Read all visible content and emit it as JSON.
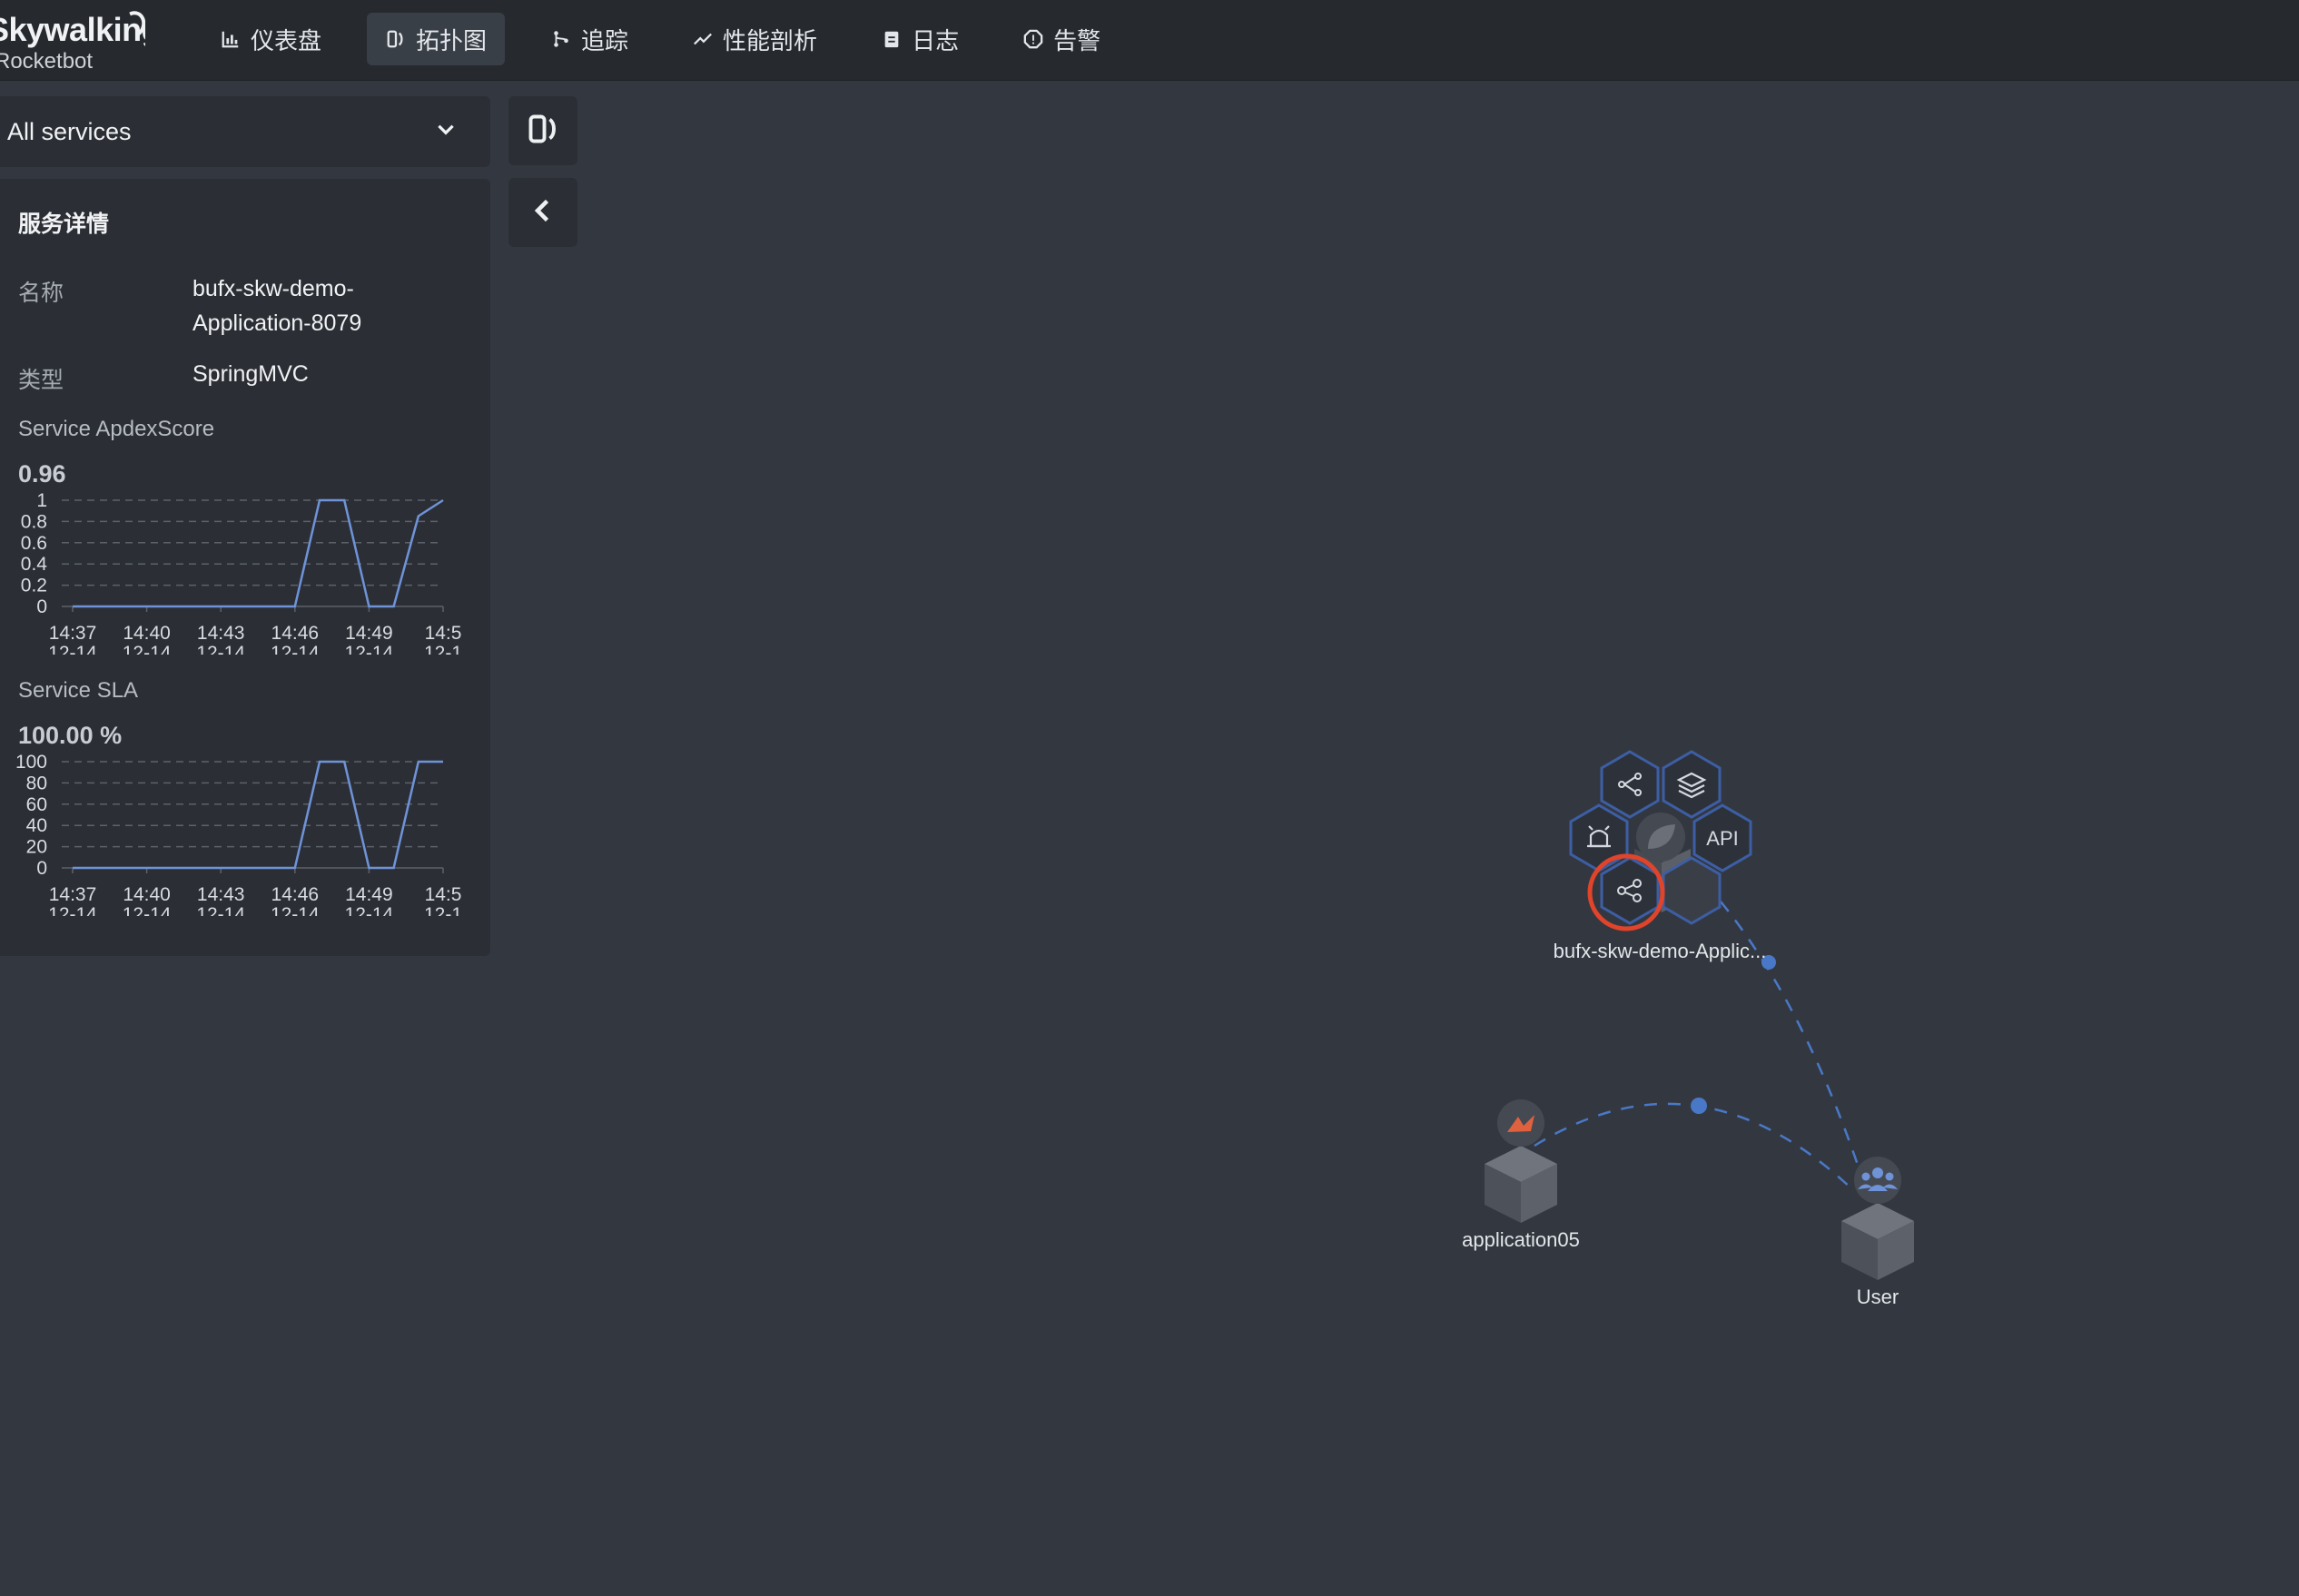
{
  "logo": {
    "line1": "Skywalking",
    "line2": "Rocketbot"
  },
  "nav": [
    {
      "id": "dashboard",
      "label": "仪表盘",
      "icon": "bar-chart-icon",
      "active": false
    },
    {
      "id": "topology",
      "label": "拓扑图",
      "icon": "topology-icon",
      "active": true
    },
    {
      "id": "trace",
      "label": "追踪",
      "icon": "branch-icon",
      "active": false
    },
    {
      "id": "profile",
      "label": "性能剖析",
      "icon": "trend-icon",
      "active": false
    },
    {
      "id": "log",
      "label": "日志",
      "icon": "clipboard-icon",
      "active": false
    },
    {
      "id": "alarm",
      "label": "告警",
      "icon": "alert-icon",
      "active": false
    }
  ],
  "service_select": {
    "value": "All services",
    "icon": "chevron-down-icon"
  },
  "tools": {
    "layout_icon": "topology-layout-icon",
    "collapse_icon": "chevron-left-icon"
  },
  "details": {
    "title": "服务详情",
    "name_label": "名称",
    "name_line1": "bufx-skw-demo-",
    "name_line2": "Application-8079",
    "type_label": "类型",
    "type_value": "SpringMVC"
  },
  "apdex": {
    "title": "Service ApdexScore",
    "value": "0.96",
    "y_ticks": [
      "1",
      "0.8",
      "0.6",
      "0.4",
      "0.2",
      "0"
    ],
    "x_ticks": [
      [
        "14:37",
        "12-14"
      ],
      [
        "14:40",
        "12-14"
      ],
      [
        "14:43",
        "12-14"
      ],
      [
        "14:46",
        "12-14"
      ],
      [
        "14:49",
        "12-14"
      ],
      [
        "14:5",
        "12-1"
      ]
    ]
  },
  "sla": {
    "title": "Service SLA",
    "value": "100.00 %",
    "y_ticks": [
      "100",
      "80",
      "60",
      "40",
      "20",
      "0"
    ],
    "x_ticks": [
      [
        "14:37",
        "12-14"
      ],
      [
        "14:40",
        "12-14"
      ],
      [
        "14:43",
        "12-14"
      ],
      [
        "14:46",
        "12-14"
      ],
      [
        "14:49",
        "12-14"
      ],
      [
        "14:5",
        "12-1"
      ]
    ]
  },
  "chart_data": [
    {
      "type": "line",
      "title": "Service ApdexScore",
      "ylim": [
        0,
        1
      ],
      "x": [
        "14:37",
        "14:38",
        "14:39",
        "14:40",
        "14:41",
        "14:42",
        "14:43",
        "14:44",
        "14:45",
        "14:46",
        "14:47",
        "14:48",
        "14:49",
        "14:50",
        "14:51",
        "14:52"
      ],
      "values": [
        0,
        0,
        0,
        0,
        0,
        0,
        0,
        0,
        0,
        0,
        1,
        1,
        0,
        0,
        0.85,
        1
      ]
    },
    {
      "type": "line",
      "title": "Service SLA",
      "ylim": [
        0,
        100
      ],
      "x": [
        "14:37",
        "14:38",
        "14:39",
        "14:40",
        "14:41",
        "14:42",
        "14:43",
        "14:44",
        "14:45",
        "14:46",
        "14:47",
        "14:48",
        "14:49",
        "14:50",
        "14:51",
        "14:52"
      ],
      "values": [
        0,
        0,
        0,
        0,
        0,
        0,
        0,
        0,
        0,
        0,
        100,
        100,
        0,
        0,
        100,
        100
      ]
    }
  ],
  "topology": {
    "nodes": [
      {
        "id": "app8079",
        "label": "bufx-skw-demo-Applic...",
        "icon": "spring-leaf-icon"
      },
      {
        "id": "app05",
        "label": "application05",
        "icon": "bird-icon"
      },
      {
        "id": "user",
        "label": "User",
        "icon": "users-icon"
      }
    ],
    "hex_menu": [
      {
        "id": "trace",
        "icon": "trace-icon"
      },
      {
        "id": "instances",
        "icon": "layers-icon"
      },
      {
        "id": "alarm",
        "icon": "alarm-icon"
      },
      {
        "id": "endpoint",
        "icon": "api-icon",
        "text": "API"
      },
      {
        "id": "dependency",
        "icon": "share-nodes-icon",
        "highlighted": true
      }
    ],
    "colors": {
      "line": "#4a78c8",
      "hex_border": "#3d5ea5",
      "highlight": "#e0442b"
    }
  }
}
